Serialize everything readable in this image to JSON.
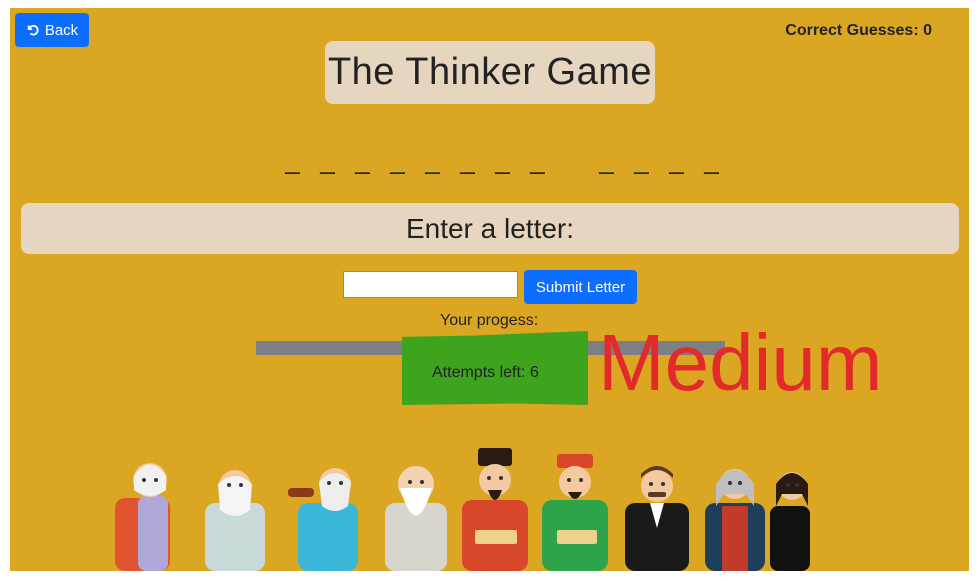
{
  "back_label": "Back",
  "correct_guesses": "Correct Guesses: 0",
  "title": "The Thinker Game",
  "word_blanks": [
    "_",
    "_",
    "_",
    "_",
    "_",
    "_",
    "_",
    "_",
    " ",
    "_",
    "_",
    "_",
    "_"
  ],
  "prompt": "Enter a letter:",
  "letter_input": {
    "value": "",
    "placeholder": ""
  },
  "submit_label": "Submit Letter",
  "progress_label": "Your progess:",
  "progress": 0,
  "attempts_left": "Attempts left: 6",
  "difficulty": "Medium",
  "colors": {
    "background": "#dba723",
    "panel": "#e6d6c0",
    "button": "#0d6efd",
    "progress_track": "#7c7f86",
    "difficulty_block": "#3ea31d",
    "difficulty_text": "#e32a2a"
  }
}
